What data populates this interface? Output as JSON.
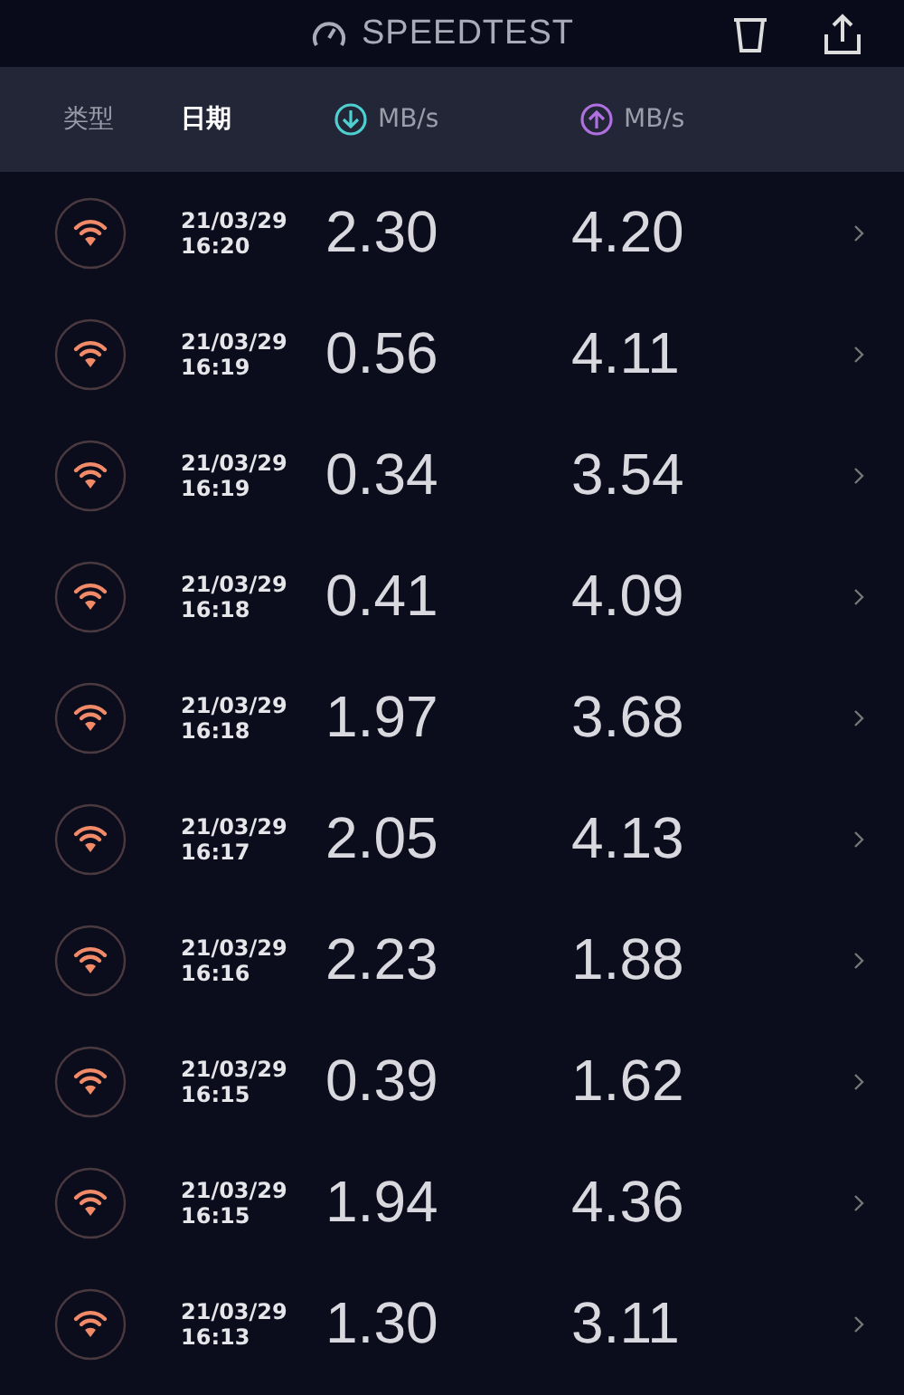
{
  "app_bar": {
    "title": "SPEEDTEST"
  },
  "columns": [
    {
      "label": "类型",
      "selected": false,
      "kind": "text"
    },
    {
      "label": "日期",
      "selected": true,
      "kind": "text"
    },
    {
      "label": "MB/s",
      "selected": false,
      "kind": "download"
    },
    {
      "label": "MB/s",
      "selected": false,
      "kind": "upload"
    }
  ],
  "results": [
    {
      "date": "21/03/29",
      "time": "16:20",
      "download": "2.30",
      "upload": "4.20"
    },
    {
      "date": "21/03/29",
      "time": "16:19",
      "download": "0.56",
      "upload": "4.11"
    },
    {
      "date": "21/03/29",
      "time": "16:19",
      "download": "0.34",
      "upload": "3.54"
    },
    {
      "date": "21/03/29",
      "time": "16:18",
      "download": "0.41",
      "upload": "4.09"
    },
    {
      "date": "21/03/29",
      "time": "16:18",
      "download": "1.97",
      "upload": "3.68"
    },
    {
      "date": "21/03/29",
      "time": "16:17",
      "download": "2.05",
      "upload": "4.13"
    },
    {
      "date": "21/03/29",
      "time": "16:16",
      "download": "2.23",
      "upload": "1.88"
    },
    {
      "date": "21/03/29",
      "time": "16:15",
      "download": "0.39",
      "upload": "1.62"
    },
    {
      "date": "21/03/29",
      "time": "16:15",
      "download": "1.94",
      "upload": "4.36"
    },
    {
      "date": "21/03/29",
      "time": "16:13",
      "download": "1.30",
      "upload": "3.11"
    }
  ]
}
